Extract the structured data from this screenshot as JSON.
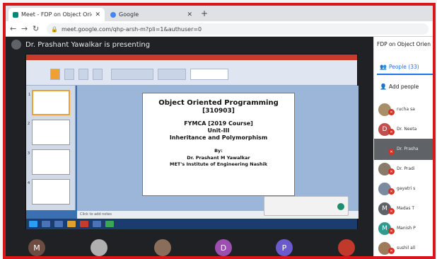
{
  "browser": {
    "tabs": [
      {
        "title": "Meet - FDP on Object Orient",
        "active": true
      },
      {
        "title": "Google",
        "active": false
      }
    ],
    "url": "meet.google.com/qhp-arsh-m?pli=1&authuser=0"
  },
  "meet": {
    "presenting_text": "Dr. Prashant Yawalkar is presenting",
    "panel_title": "FDP on Object Orien",
    "people_tab": "People (33)",
    "add_people": "Add people",
    "participants": [
      {
        "name": "rucha sa",
        "initial": "",
        "color": "#a88f6a"
      },
      {
        "name": "Dr. Neeta",
        "initial": "D",
        "color": "#c0504d"
      },
      {
        "name": "Dr. Prasha",
        "initial": "",
        "color": "#5f6368"
      },
      {
        "name": "Dr. Pradi",
        "initial": "",
        "color": "#8a7a6a"
      },
      {
        "name": "gayatri s",
        "initial": "",
        "color": "#7c8aa0"
      },
      {
        "name": "Madas T",
        "initial": "M",
        "color": "#5f6368"
      },
      {
        "name": "Manish P",
        "initial": "M",
        "color": "#2e9b8f"
      },
      {
        "name": "sushil all",
        "initial": "",
        "color": "#9c7a5a"
      }
    ],
    "strip": [
      {
        "initial": "M",
        "color": "#6d4c41"
      },
      {
        "initial": "",
        "color": "#b0b0b0"
      },
      {
        "initial": "",
        "color": "#8a6d5a"
      },
      {
        "initial": "D",
        "color": "#9c4fb0"
      },
      {
        "initial": "P",
        "color": "#6a5acd"
      },
      {
        "initial": "",
        "color": "#c0392b"
      }
    ]
  },
  "slide": {
    "line1": "Object Oriented Programming",
    "line2": "[310903]",
    "line3": "FYMCA [2019 Course]",
    "line4": "Unit-III",
    "line5": "Inheritance and Polymorphism",
    "line6": "By:",
    "line7": "Dr. Prashant M Yawalkar",
    "line8": "MET's Institute of Engineering Nashik"
  },
  "ppt": {
    "notes": "Click to add notes"
  }
}
